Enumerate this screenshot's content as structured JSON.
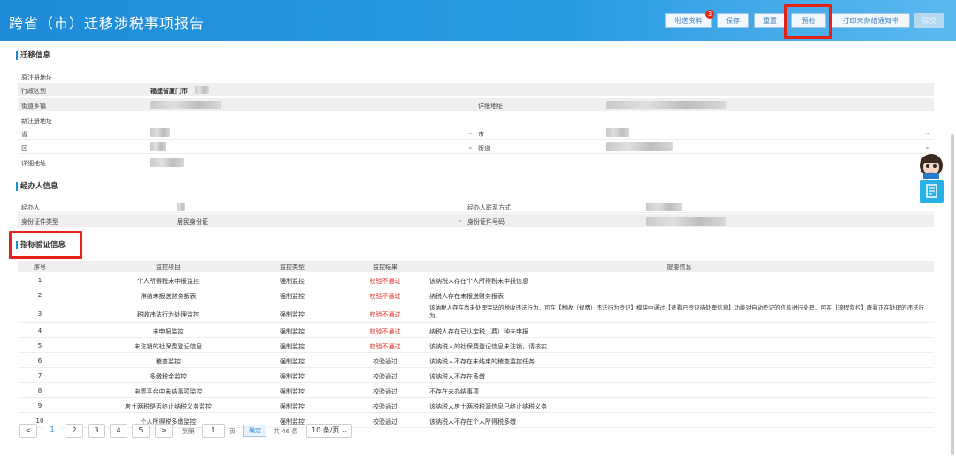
{
  "header": {
    "title": "跨省（市）迁移涉税事项报告",
    "buttons": {
      "attachments": "附送资料",
      "attachments_badge": "3",
      "save": "保存",
      "reset": "重置",
      "precheck": "预检",
      "print": "打印未办结通知书",
      "submit": "提交"
    }
  },
  "migration": {
    "title": "迁移信息",
    "original_address": "原注册地址",
    "admin_region_label": "行政区划",
    "admin_region_value": "福建省厦门市",
    "street_label": "街道乡镇",
    "detail_address_label": "详细地址",
    "new_address": "新注册地址",
    "province_label": "省",
    "city_label": "市",
    "district_label": "区",
    "street2_label": "街道",
    "detail_address2_label": "详细地址"
  },
  "agent": {
    "title": "经办人信息",
    "agent_label": "经办人",
    "contact_label": "经办人联系方式",
    "id_type_label": "身份证件类型",
    "id_type_value": "居民身份证",
    "id_number_label": "身份证件号码"
  },
  "indicators": {
    "title": "指标验证信息",
    "columns": [
      "序号",
      "监控项目",
      "监控类型",
      "监控结果",
      "提要信息"
    ],
    "rows": [
      {
        "no": "1",
        "item": "个人所得税未申报监控",
        "type": "强制监控",
        "result": "校验不通过",
        "fail": true,
        "info": "该纳税人存在个人所得税未申报信息"
      },
      {
        "no": "2",
        "item": "滞纳未报送财务报表",
        "type": "强制监控",
        "result": "校验不通过",
        "fail": true,
        "info": "纳税人存在未报送财务报表"
      },
      {
        "no": "3",
        "item": "税收违法行为处理监控",
        "type": "强制监控",
        "result": "校验不通过",
        "fail": true,
        "info": "该纳税人存在尚未处理完毕的税收违法行为，可在【税收（规费）违法行为登记】模块中通过【查看已登记待处理信息】功能对自动登记的信息进行处理，可在【流程监控】查看正在处理的违法行为。"
      },
      {
        "no": "4",
        "item": "未申报监控",
        "type": "强制监控",
        "result": "校验不通过",
        "fail": true,
        "info": "纳税人存在已认定税（费）种未申报"
      },
      {
        "no": "5",
        "item": "未注销的社保费登记信息",
        "type": "强制监控",
        "result": "校验不通过",
        "fail": true,
        "info": "该纳税人的社保费登记信息未注销，请核实"
      },
      {
        "no": "6",
        "item": "稽查监控",
        "type": "强制监控",
        "result": "校验通过",
        "fail": false,
        "info": "该纳税人不存在未结束的稽查监控任务"
      },
      {
        "no": "7",
        "item": "多缴税金监控",
        "type": "强制监控",
        "result": "校验通过",
        "fail": false,
        "info": "该纳税人不存在多缴"
      },
      {
        "no": "8",
        "item": "电票平台中未结事项监控",
        "type": "强制监控",
        "result": "校验通过",
        "fail": false,
        "info": "不存在未办结事项"
      },
      {
        "no": "9",
        "item": "房土两税是否终止纳税义务监控",
        "type": "强制监控",
        "result": "校验通过",
        "fail": false,
        "info": "该纳税人房土两税税源信息已终止纳税义务"
      },
      {
        "no": "10",
        "item": "个人所得税多缴监控",
        "type": "强制监控",
        "result": "校验通过",
        "fail": false,
        "info": "该纳税人不存在个人所得税多缴"
      }
    ]
  },
  "pager": {
    "prev": "<",
    "pages": [
      "1",
      "2",
      "3",
      "4",
      "5"
    ],
    "next": ">",
    "goto_label": "到第",
    "goto_value": "1",
    "page_unit": "页",
    "confirm": "确定",
    "total": "共 46 条",
    "page_size": "10 条/页"
  },
  "colors": {
    "header_blue": "#1f8bd8",
    "fail_red": "#e0281e",
    "highlight_red": "#e6211a"
  }
}
